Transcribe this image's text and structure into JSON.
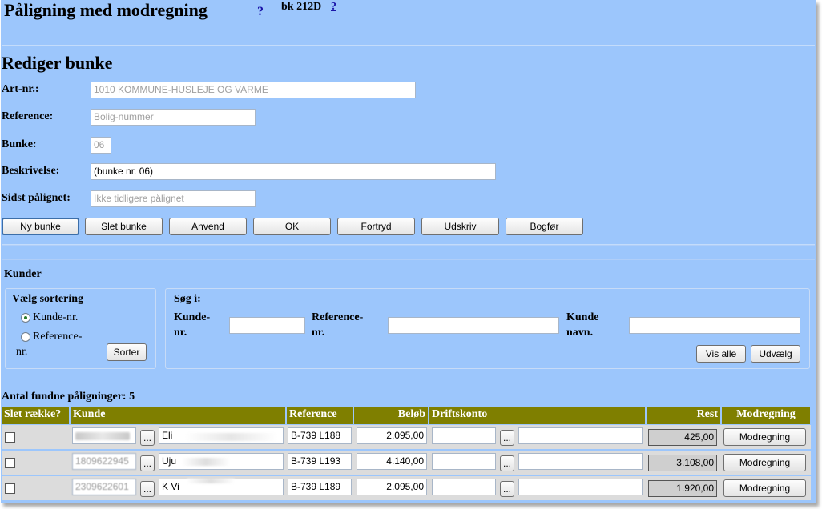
{
  "header": {
    "title": "Påligning med modregning",
    "help_glyph": "?",
    "code": "bk 212D",
    "code_help": "?"
  },
  "edit": {
    "heading": "Rediger bunke",
    "art_label": "Art-nr.:",
    "art_value": "1010 KOMMUNE-HUSLEJE OG VARME",
    "ref_label": "Reference:",
    "ref_value": "Bolig-nummer",
    "bunke_label": "Bunke:",
    "bunke_value": "06",
    "beskr_label": "Beskrivelse:",
    "beskr_value": "(bunke nr. 06)",
    "sidst_label": "Sidst pålignet:",
    "sidst_value": "Ikke tidligere pålignet"
  },
  "actions": {
    "ny": "Ny bunke",
    "slet": "Slet bunke",
    "anvend": "Anvend",
    "ok": "OK",
    "fortryd": "Fortryd",
    "udskriv": "Udskriv",
    "bogfor": "Bogfør"
  },
  "kunder": {
    "heading": "Kunder",
    "sort_title": "Vælg sortering",
    "sort_opt1": "Kunde-nr.",
    "sort_opt2_a": "Reference-",
    "sort_opt2_b": "nr.",
    "sort_btn": "Sorter",
    "search_title": "Søg i:",
    "kundenr_a": "Kunde-",
    "kundenr_b": "nr.",
    "refnr_a": "Reference-",
    "refnr_b": "nr.",
    "navn_a": "Kunde",
    "navn_b": "navn.",
    "vis_alle": "Vis alle",
    "udvaelg": "Udvælg"
  },
  "results": {
    "count_text": "Antal fundne påligninger: 5",
    "columns": {
      "slet": "Slet række?",
      "kunde": "Kunde",
      "reference": "Reference",
      "belob": "Beløb",
      "drift": "Driftskonto",
      "rest": "Rest",
      "modregning": "Modregning"
    },
    "rows": [
      {
        "kundenr": "",
        "navn": "Eli",
        "reference": "B-739 L188",
        "belob": "2.095,00",
        "rest": "425,00",
        "btn": "Modregning"
      },
      {
        "kundenr": "1809622945",
        "navn": "Uju",
        "reference": "B-739 L193",
        "belob": "4.140,00",
        "rest": "3.108,00",
        "btn": "Modregning"
      },
      {
        "kundenr": "2309622601",
        "navn": "K Vi",
        "reference": "B-739 L189",
        "belob": "2.095,00",
        "rest": "1.920,00",
        "btn": "Modregning"
      }
    ],
    "ellipsis": "..."
  },
  "colors": {
    "background": "#9cc6fc",
    "table_header": "#7f7f00",
    "help_link": "#1a14a8"
  }
}
